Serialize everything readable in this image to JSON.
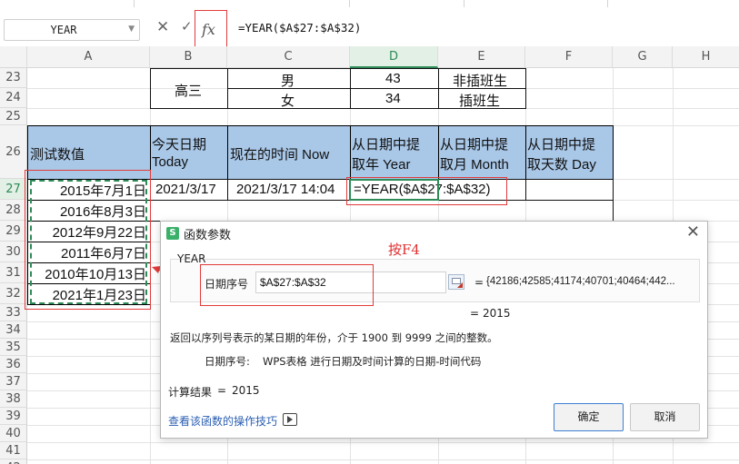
{
  "formula_bar": {
    "name_box": "YEAR",
    "cancel_icon": "close-icon",
    "confirm_icon": "check-icon",
    "fx_label": "fx",
    "formula": "=YEAR($A$27:$A$32)"
  },
  "columns": [
    "A",
    "B",
    "C",
    "D",
    "E",
    "F",
    "G",
    "H"
  ],
  "selected_column": "D",
  "rows": [
    "23",
    "24",
    "25",
    "26",
    "27",
    "28",
    "29",
    "30",
    "31",
    "32",
    "33",
    "34",
    "35",
    "36",
    "37",
    "38",
    "39",
    "40",
    "41",
    "42"
  ],
  "selected_row": "27",
  "upper_table": {
    "grade": "高三",
    "rows": [
      {
        "gender": "男",
        "count": "43",
        "type": "非插班生"
      },
      {
        "gender": "女",
        "count": "34",
        "type": "插班生"
      }
    ]
  },
  "test_table": {
    "headers": {
      "a": "测试数值",
      "b": [
        "今天日期",
        "Today"
      ],
      "c": "现在的时间 Now",
      "d": [
        "从日期中提",
        "取年 Year"
      ],
      "e": [
        "从日期中提",
        "取月 Month"
      ],
      "f": [
        "从日期中提",
        "取天数 Day"
      ]
    },
    "dates": [
      "2015年7月1日",
      "2016年8月3日",
      "2012年9月22日",
      "2011年6月7日",
      "2010年10月13日",
      "2021年1月23日"
    ],
    "today": "2021/3/17",
    "now": "2021/3/17 14:04",
    "year_formula": "=YEAR($A$27:$A$32)"
  },
  "annotation_note": "按F4",
  "dialog": {
    "title": "函数参数",
    "close_icon": "close-icon",
    "function_name": "YEAR",
    "arg_label": "日期序号",
    "arg_value": "$A$27:$A$32",
    "arg_eq": "=",
    "arg_result": "{42186;42585;41174;40701;40464;442...",
    "result_eq": "=",
    "result_value": "2015",
    "description": "返回以序列号表示的某日期的年份，介于 1900 到 9999 之间的整数。",
    "param_label": "日期序号:",
    "param_description": "WPS表格 进行日期及时间计算的日期-时间代码",
    "calc_label": "计算结果",
    "calc_eq": "=",
    "calc_value": "2015",
    "help_link": "查看该函数的操作技巧",
    "ok": "确定",
    "cancel": "取消"
  },
  "colors": {
    "header_fill": "#a9c7e7",
    "selection_green": "#2e8b57",
    "annotation_red": "#e23b3b",
    "ok_border": "#3d7fd1"
  }
}
